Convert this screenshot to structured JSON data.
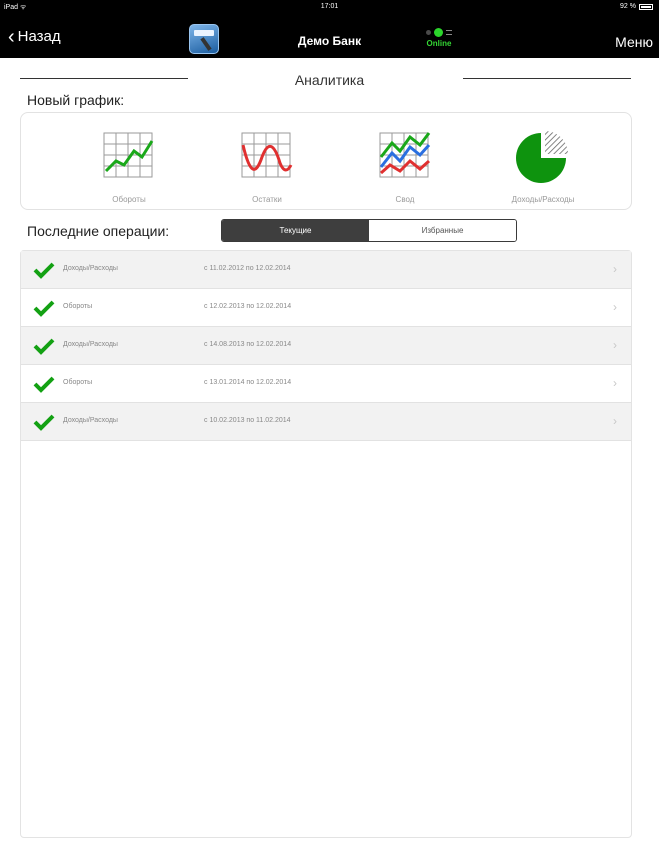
{
  "status_bar": {
    "device": "iPad",
    "time": "17:01",
    "battery": "92 %"
  },
  "nav": {
    "back_label": "Назад",
    "title": "Демо Банк",
    "online_label": "Online",
    "menu_label": "Меню"
  },
  "page_title": "Аналитика",
  "new_chart": {
    "label": "Новый график:",
    "tiles": [
      {
        "label": "Обороты",
        "icon": "turnover-chart-icon"
      },
      {
        "label": "Остатки",
        "icon": "balance-chart-icon"
      },
      {
        "label": "Свод",
        "icon": "summary-chart-icon"
      },
      {
        "label": "Доходы/Расходы",
        "icon": "income-expense-pie-icon"
      }
    ]
  },
  "recent": {
    "label": "Последние операции:",
    "segments": [
      "Текущие",
      "Избранные"
    ],
    "selected_segment": "Текущие",
    "rows": [
      {
        "name": "Доходы/Расходы",
        "period": "с 11.02.2012 по 12.02.2014"
      },
      {
        "name": "Обороты",
        "period": "с 12.02.2013 по 12.02.2014"
      },
      {
        "name": "Доходы/Расходы",
        "period": "с 14.08.2013 по 12.02.2014"
      },
      {
        "name": "Обороты",
        "period": "с 13.01.2014 по 12.02.2014"
      },
      {
        "name": "Доходы/Расходы",
        "period": "с 10.02.2013 по 11.02.2014"
      }
    ]
  },
  "colors": {
    "accent_green": "#13a113",
    "nav_bg": "#000000",
    "online_green": "#34d634"
  }
}
